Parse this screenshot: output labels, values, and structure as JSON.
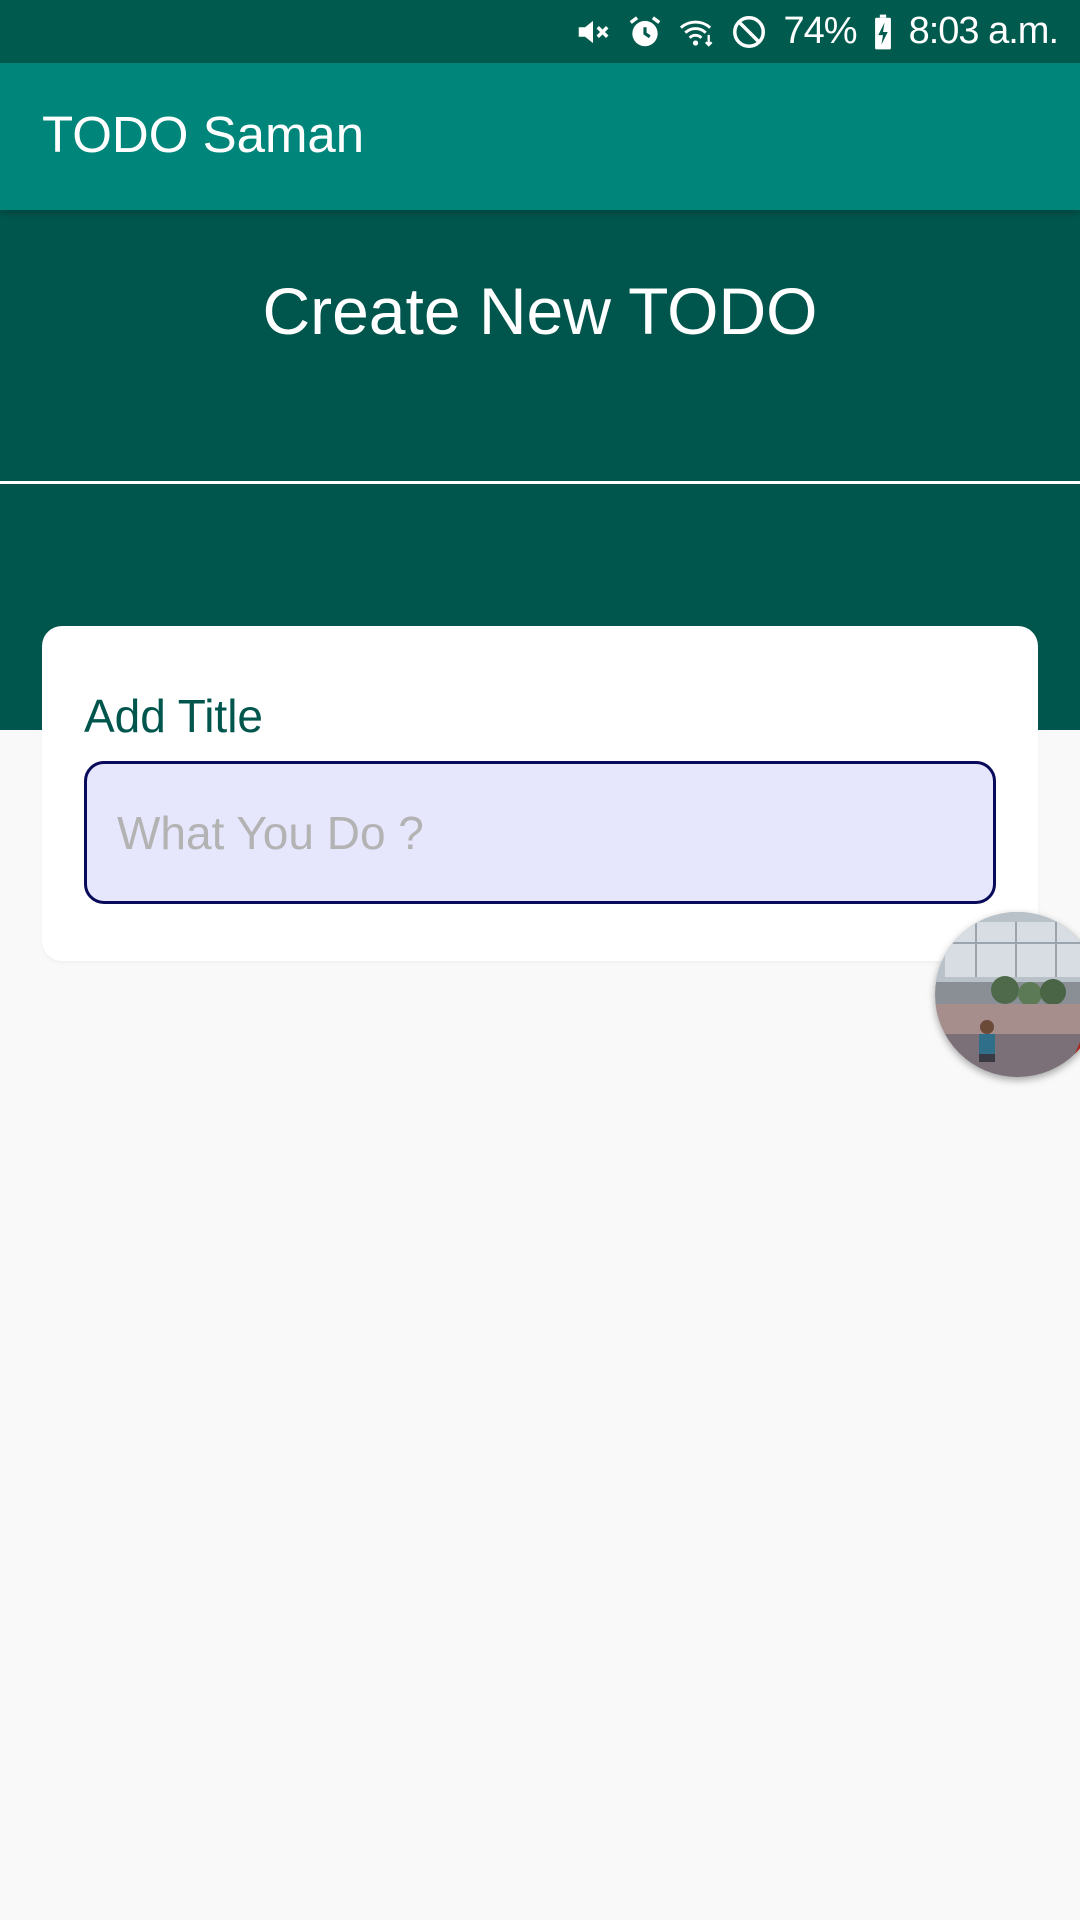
{
  "status_bar": {
    "icons": [
      "mute-icon",
      "alarm-icon",
      "wifi-icon",
      "do-not-disturb-icon",
      "battery-charging-icon"
    ],
    "battery_percent": "74%",
    "time": "8:03 a.m."
  },
  "app_bar": {
    "title": "TODO Saman"
  },
  "header": {
    "title": "Create New TODO"
  },
  "form": {
    "title_label": "Add Title",
    "title_placeholder": "What You Do ?",
    "title_value": ""
  },
  "chat_head": {
    "icon": "chat-head-avatar-icon"
  },
  "colors": {
    "status_bar": "#005a4e",
    "app_bar": "#00857a",
    "header_band": "#00564d",
    "background": "#f9f9f9",
    "input_fill": "#e6e6fd",
    "input_border": "#0a0a5a",
    "label_text": "#00564d"
  }
}
